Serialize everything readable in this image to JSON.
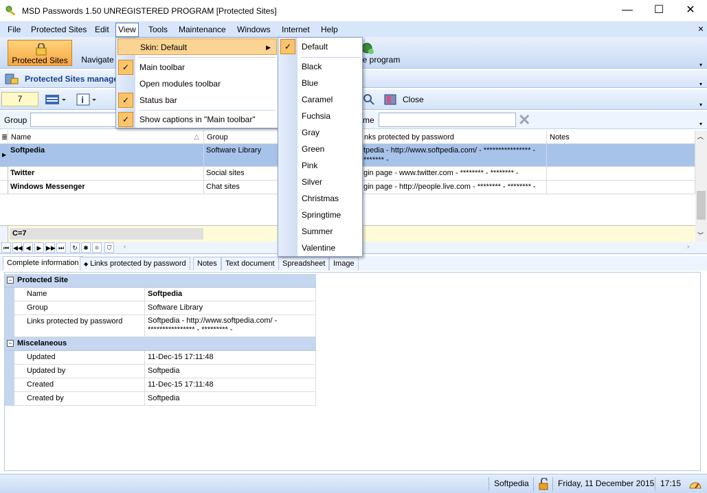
{
  "window": {
    "title": "MSD Passwords 1.50 UNREGISTERED PROGRAM [Protected Sites]",
    "minimize_glyph": "—",
    "maximize_glyph": "☐",
    "close_glyph": "✕"
  },
  "menubar": {
    "items": [
      "File",
      "Protected Sites",
      "Edit",
      "View",
      "Tools",
      "Maintenance",
      "Windows",
      "Internet",
      "Help"
    ]
  },
  "toolbar1": {
    "protected_sites": "Protected Sites",
    "navigate": "Navigate",
    "close_program": "e program"
  },
  "panel": {
    "title": "Protected Sites manage"
  },
  "toolbar2": {
    "count": "7",
    "close_label": "Close"
  },
  "filter": {
    "group_label": "Group",
    "name_label": "me"
  },
  "grid": {
    "columns": [
      "Name",
      "Group",
      "nks protected by password",
      "Notes"
    ],
    "rows": [
      {
        "name": "Softpedia",
        "group": "Software Library",
        "links": "tpedia - http://www.softpedia.com/ - **************** -",
        "links2": "******* -"
      },
      {
        "name": "Twitter",
        "group": "Social sites",
        "links": "gin page - www.twitter.com - ******** - ******** -",
        "links2": ""
      },
      {
        "name": "Windows Messenger",
        "group": "Chat sites",
        "links": "gin page - http://people.live.com - ******** - ******** -",
        "links2": ""
      }
    ],
    "footer_count": "C=7"
  },
  "view_menu": {
    "items": [
      {
        "label": "Skin:  Default",
        "checked": false,
        "submenu": true
      },
      {
        "label": "Main toolbar",
        "checked": true
      },
      {
        "label": "Open modules toolbar",
        "checked": false
      },
      {
        "label": "Status bar",
        "checked": true
      },
      {
        "label": "Show captions in \"Main toolbar\"",
        "checked": true
      }
    ]
  },
  "skin_menu": {
    "items": [
      "Default",
      "Black",
      "Blue",
      "Caramel",
      "Fuchsia",
      "Gray",
      "Green",
      "Pink",
      "Silver",
      "Christmas",
      "Springtime",
      "Summer",
      "Valentine"
    ],
    "checked": "Default"
  },
  "tabs": [
    "Complete information",
    "Links protected by password",
    "Notes",
    "Text document",
    "Spreadsheet",
    "Image"
  ],
  "properties": {
    "cat1": "Protected Site",
    "cat2": "Miscelaneous",
    "rows1": [
      {
        "name": "Name",
        "value": "Softpedia",
        "bold": true
      },
      {
        "name": "Group",
        "value": "Software Library"
      },
      {
        "name": "Links protected by password",
        "value": "Softpedia - http://www.softpedia.com/ -",
        "value2": "**************** - ********* -"
      }
    ],
    "rows2": [
      {
        "name": "Updated",
        "value": "11-Dec-15 17:11:48"
      },
      {
        "name": "Updated by",
        "value": "Softpedia"
      },
      {
        "name": "Created",
        "value": "11-Dec-15 17:11:48"
      },
      {
        "name": "Created by",
        "value": "Softpedia"
      }
    ]
  },
  "statusbar": {
    "user": "Softpedia",
    "date": "Friday, 11 December 2015",
    "time": "17:15"
  },
  "colors": {
    "accent": "#fbc46b",
    "menubar": "#d7e6fb",
    "selected_row": "#a8c3ea"
  }
}
